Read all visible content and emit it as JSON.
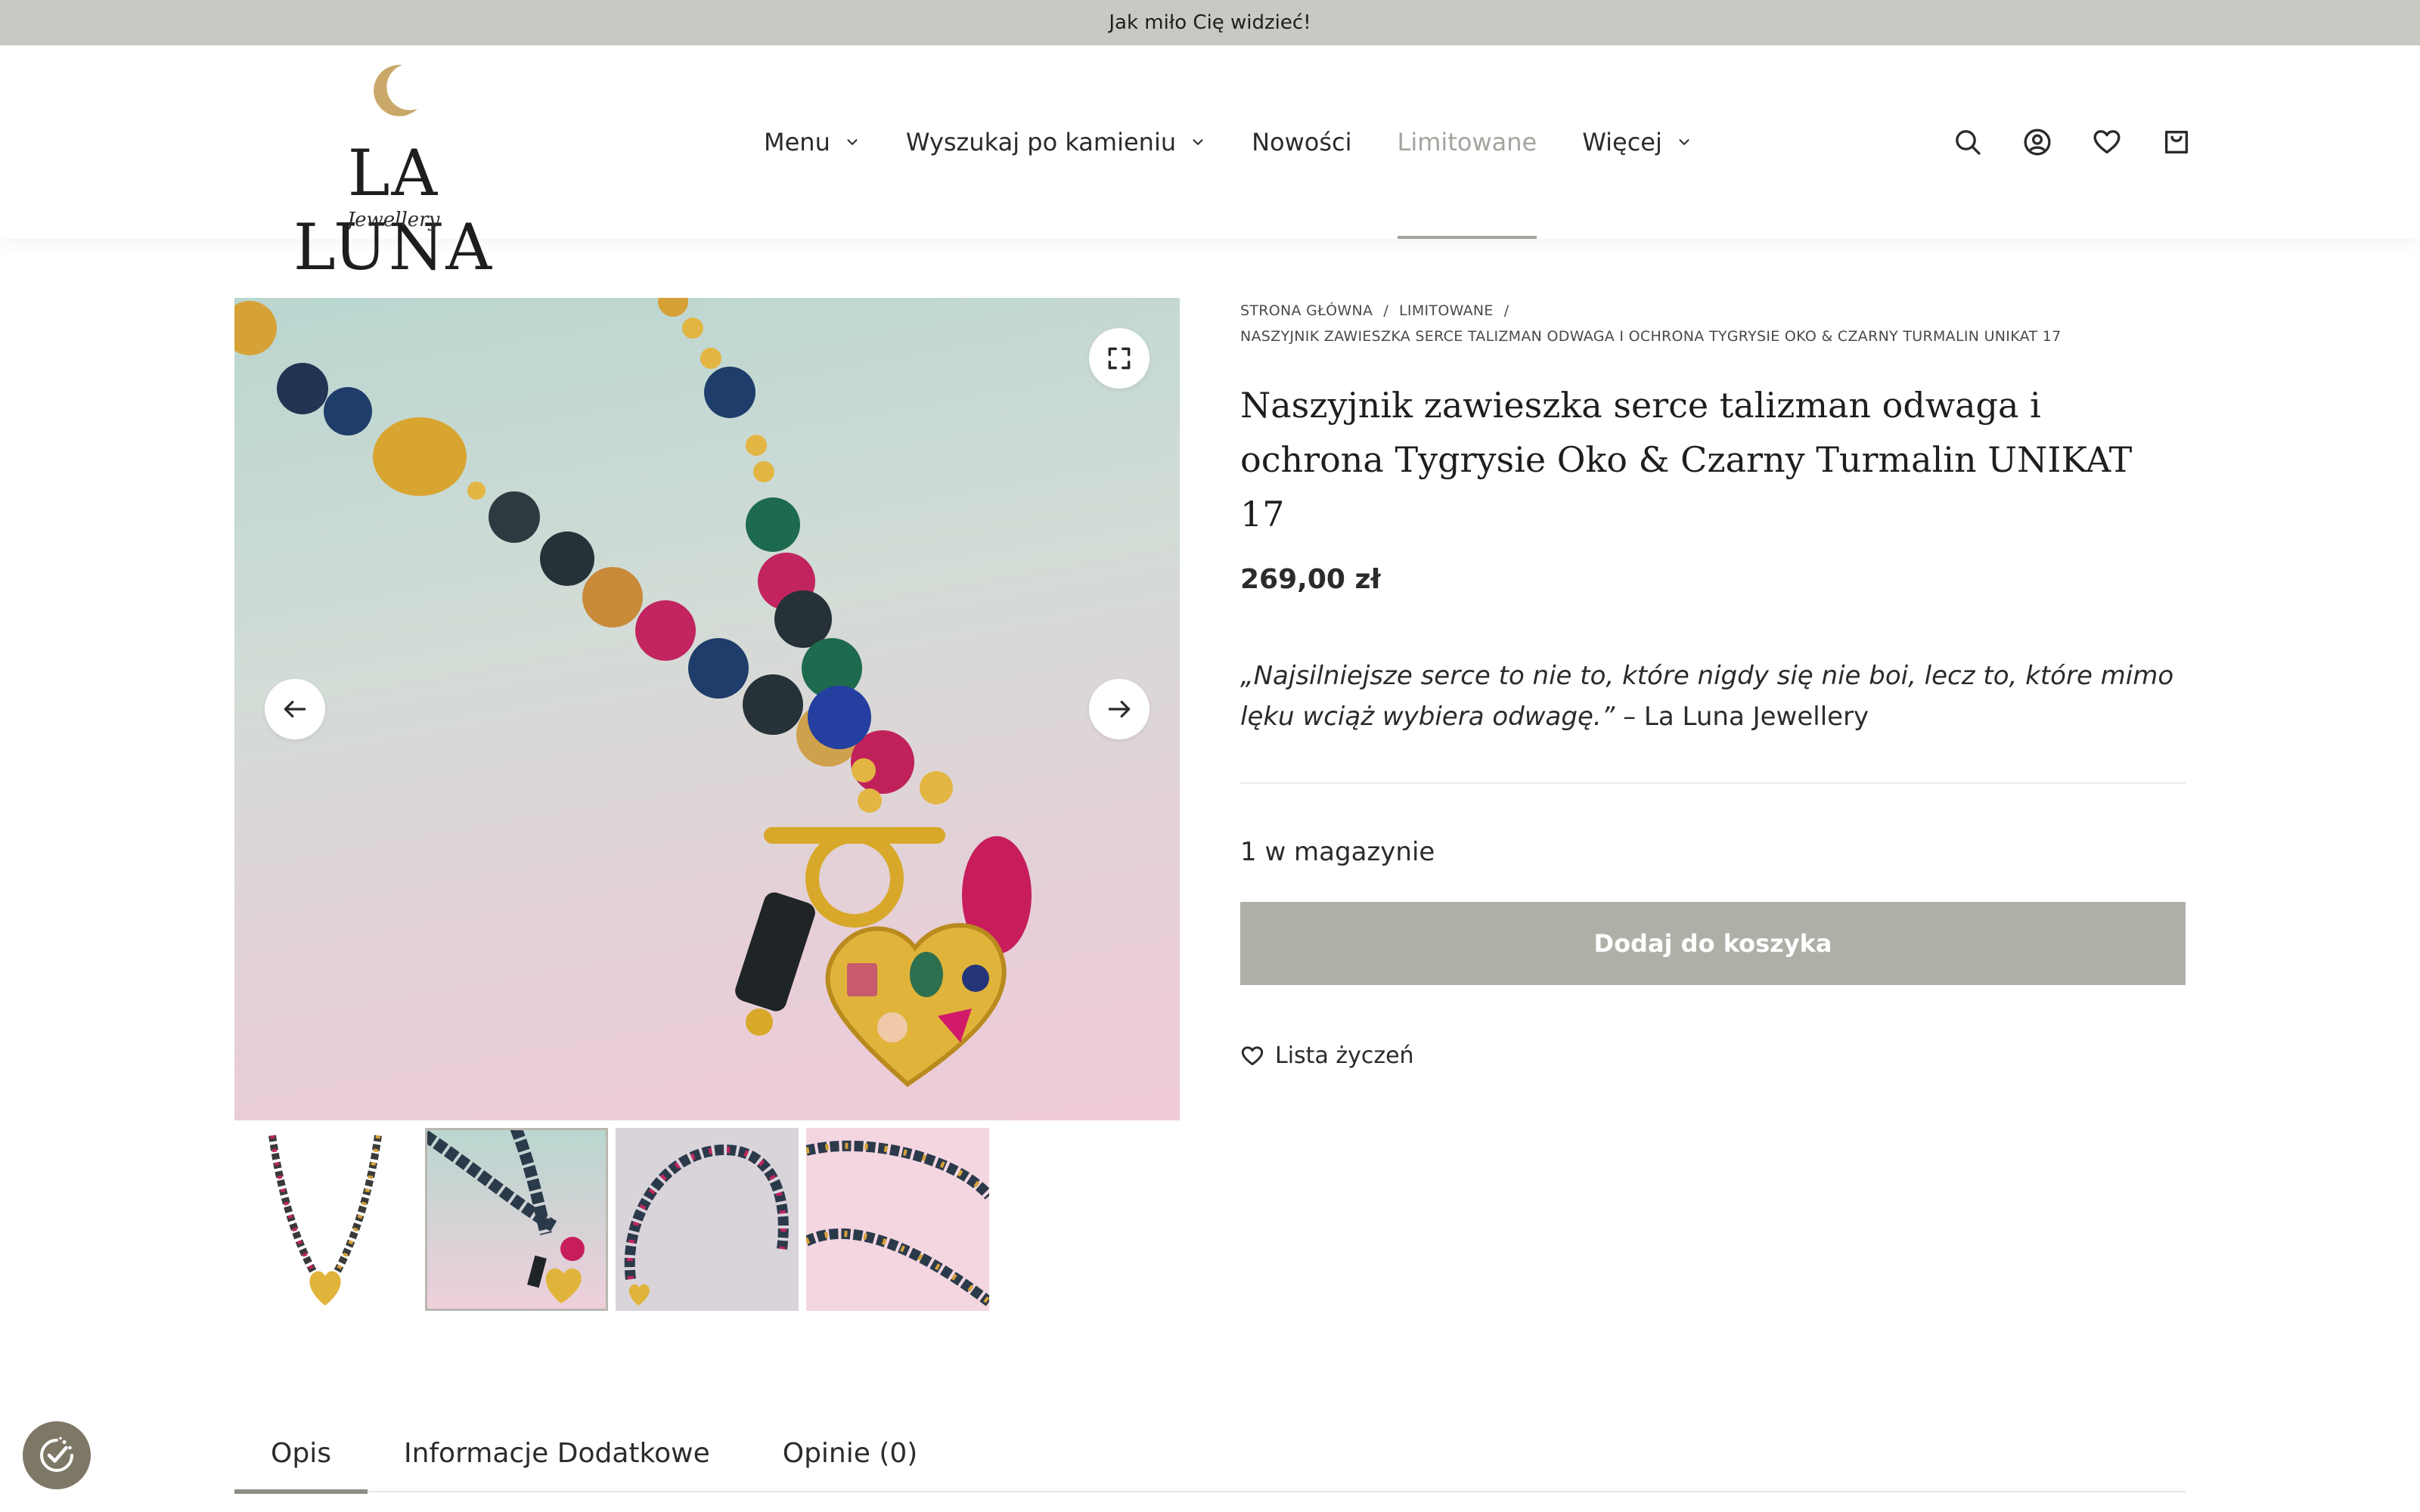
{
  "announcement": "Jak miło Cię widzieć!",
  "logo": {
    "wordmark": "LA LUNA",
    "tagline": "Jewellery"
  },
  "nav": [
    {
      "label": "Menu",
      "dropdown": true
    },
    {
      "label": "Wyszukaj po kamieniu",
      "dropdown": true
    },
    {
      "label": "Nowości",
      "dropdown": false
    },
    {
      "label": "Limitowane",
      "dropdown": false,
      "active": true
    },
    {
      "label": "Więcej",
      "dropdown": true
    }
  ],
  "header_icons": [
    "search-icon",
    "account-icon",
    "heart-icon",
    "cart-icon"
  ],
  "breadcrumb": {
    "home": "STRONA GŁÓWNA",
    "category": "LIMITOWANE",
    "current": "NASZYJNIK ZAWIESZKA SERCE TALIZMAN ODWAGA I OCHRONA TYGRYSIE OKO & CZARNY TURMALIN UNIKAT 17",
    "separator": "/"
  },
  "product": {
    "title": "Naszyjnik zawieszka serce talizman odwaga i ochrona Tygrysie Oko & Czarny Turmalin UNIKAT 17",
    "price": "269,00 zł",
    "quote": "„Najsilniejsze serce to nie to, które nigdy się nie boi, lecz to, które mimo lęku wciąż wybiera odwagę.”",
    "quote_author": " – La Luna Jewellery",
    "stock": "1 w magazynie",
    "add_to_cart": "Dodaj do koszyka",
    "wishlist": "Lista życzeń"
  },
  "gallery": {
    "selected_thumbnail": 1,
    "thumbnail_count": 4
  },
  "tabs": [
    {
      "label": "Opis",
      "active": true
    },
    {
      "label": "Informacje Dodatkowe",
      "active": false
    },
    {
      "label": "Opinie (0)",
      "active": false
    }
  ],
  "colors": {
    "topbar": "#c9c8c3",
    "accent_gold": "#c9a86a",
    "button": "#afaea7",
    "active_nav": "#a4a39d",
    "cookie_badge": "#7d7766"
  }
}
